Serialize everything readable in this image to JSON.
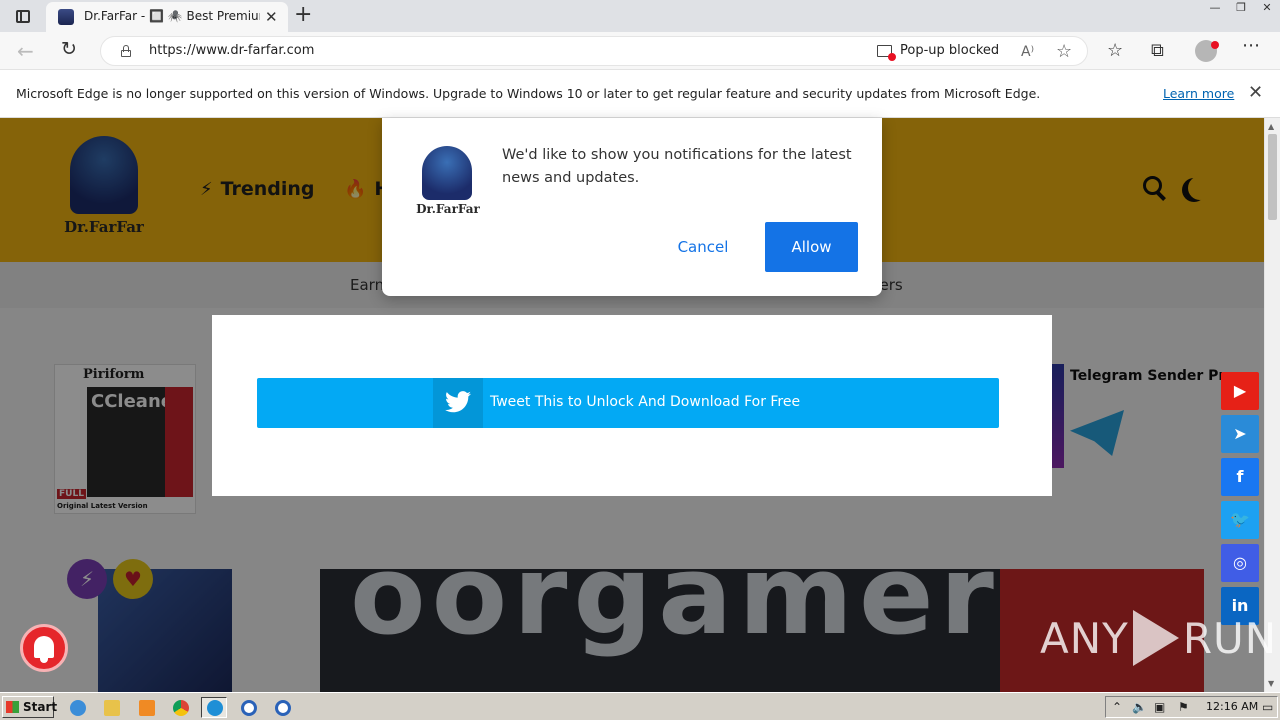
{
  "browser": {
    "tab_title": "Dr.FarFar - 🔲 🕷️ Best Premium Software",
    "tab_close": "✕",
    "new_tab": "+",
    "window_controls": [
      "—",
      "❐",
      "✕"
    ],
    "url": "https://www.dr-farfar.com",
    "popup_blocked": "Pop-up blocked",
    "read_aloud": "A⁾",
    "more": "⋯"
  },
  "infobar": {
    "message": "Microsoft Edge is no longer supported on this version of Windows. Upgrade to Windows 10 or later to get regular feature and security updates from Microsoft Edge.",
    "learn_more": "Learn more",
    "close": "✕"
  },
  "site": {
    "logo_name": "Dr.FarFar",
    "nav": [
      {
        "icon": "⚡",
        "label": "Trending"
      },
      {
        "icon": "🔥",
        "label": "H"
      }
    ],
    "subnav_left": "Earn",
    "subnav_right": "pers",
    "ccleaner": {
      "brand": "Piriform",
      "title": "CCleaner",
      "full": "FULL",
      "bottom": "Original Latest Version"
    },
    "telegram": {
      "title": "Telegram Sender Pr"
    },
    "article_big_text": "oorgamer",
    "badges": {
      "lightning": "⚡",
      "heart": "♥"
    },
    "social": [
      {
        "name": "youtube",
        "glyph": "▶",
        "color": "#e62117"
      },
      {
        "name": "telegram",
        "glyph": "➤",
        "color": "#2a8bd8"
      },
      {
        "name": "facebook",
        "glyph": "f",
        "color": "#1877f2"
      },
      {
        "name": "twitter",
        "glyph": "🐦",
        "color": "#1da1f2"
      },
      {
        "name": "instagram",
        "glyph": "◎",
        "color": "#405de6"
      },
      {
        "name": "linkedin",
        "glyph": "in",
        "color": "#0a66c2"
      }
    ]
  },
  "tweet_modal": {
    "button_label": "Tweet This to Unlock And Download For Free"
  },
  "notification": {
    "logo_name": "Dr.FarFar",
    "message": "We'd like to show you notifications for the latest news and updates.",
    "cancel": "Cancel",
    "allow": "Allow"
  },
  "watermark": {
    "left": "ANY",
    "right": "RUN"
  },
  "taskbar": {
    "start": "Start",
    "time": "12:16 AM",
    "apps": [
      {
        "name": "ie",
        "color": "#3b8dd8"
      },
      {
        "name": "explorer",
        "color": "#e8c24a"
      },
      {
        "name": "media",
        "color": "#f08a24"
      },
      {
        "name": "chrome",
        "color": "#db4437"
      },
      {
        "name": "edge",
        "color": "#1f8fd6"
      },
      {
        "name": "opera-like-1",
        "color": "#2a62b8"
      },
      {
        "name": "opera-like-2",
        "color": "#2a62b8"
      }
    ]
  },
  "colors": {
    "accent_blue": "#1473e6",
    "tweet_blue": "#03a9f4",
    "site_yellow": "#f3b511"
  }
}
